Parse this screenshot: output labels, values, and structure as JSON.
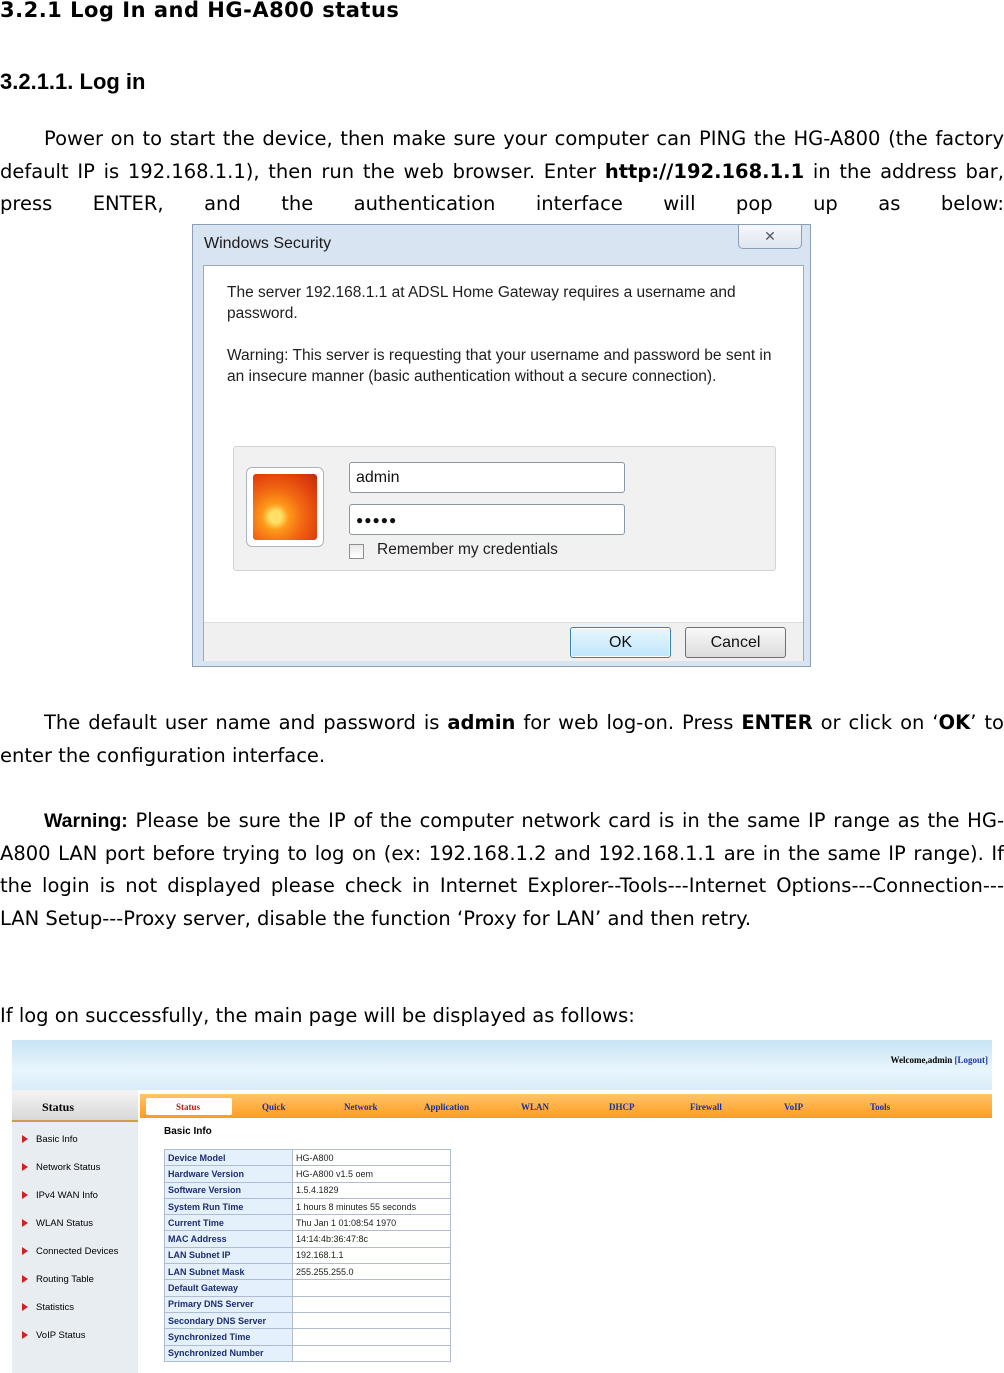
{
  "heading_1": "3.2.1  Log In and HG-A800 status",
  "heading_2": "3.2.1.1.   Log in",
  "para1": {
    "pre": "Power on to start the device, then make sure your computer can PING the HG-A800 (the factory default IP is 192.168.1.1), then run the web browser. Enter ",
    "url": "http://192.168.1.1",
    "post": " in the address bar, press ENTER, and the authentication interface will pop up as below:"
  },
  "dialog": {
    "title": "Windows Security",
    "close_label": "✕",
    "message1": "The server 192.168.1.1 at ADSL Home Gateway requires a username and password.",
    "message2": "Warning: This server is requesting that your username and password be sent in an insecure manner (basic authentication without a secure connection).",
    "username": "admin",
    "password": "●●●●●",
    "remember_label": "Remember my credentials",
    "ok_label": "OK",
    "cancel_label": "Cancel"
  },
  "para2": {
    "t1": "The default user name and password is ",
    "b1": "admin",
    "t2": " for web log-on. Press ",
    "b2": "ENTER",
    "t3": " or click on ‘",
    "b3": "OK",
    "t4": "’ to enter the configuration interface."
  },
  "para3": {
    "label": "Warning:",
    "text": " Please be sure the IP of the computer network card is in the same IP range as the HG-A800 LAN port before trying to log on (ex: 192.168.1.2 and 192.168.1.1 are in the same IP range). If the login is not displayed please check in Internet Explorer--Tools---Internet Options---Connection---LAN Setup---Proxy server, disable the function ‘Proxy for LAN’ and then retry."
  },
  "para4": "If log on successfully, the main page will be displayed as follows:",
  "router_ui": {
    "welcome": "Welcome,admin",
    "logout": "[Logout]",
    "left_header": "Status",
    "left_items": [
      "Basic Info",
      "Network Status",
      "IPv4 WAN Info",
      "WLAN Status",
      "Connected Devices",
      "Routing Table",
      "Statistics",
      "VoIP Status"
    ],
    "menu_active": "Status",
    "menu": [
      "Quick",
      "Network",
      "Application",
      "WLAN",
      "DHCP",
      "Firewall",
      "VoIP",
      "Tools"
    ],
    "section_title": "Basic Info",
    "rows": [
      {
        "k": "Device Model",
        "v": "HG-A800"
      },
      {
        "k": "Hardware Version",
        "v": "HG-A800 v1.5 oem"
      },
      {
        "k": "Software Version",
        "v": "1.5.4.1829"
      },
      {
        "k": "System Run Time",
        "v": "1 hours 8 minutes 55 seconds"
      },
      {
        "k": "Current Time",
        "v": "Thu Jan 1 01:08:54 1970"
      },
      {
        "k": "MAC Address",
        "v": "14:14:4b:36:47:8c"
      },
      {
        "k": "LAN Subnet IP",
        "v": "192.168.1.1"
      },
      {
        "k": "LAN Subnet Mask",
        "v": "255.255.255.0"
      },
      {
        "k": "Default Gateway",
        "v": ""
      },
      {
        "k": "Primary DNS Server",
        "v": ""
      },
      {
        "k": "Secondary DNS Server",
        "v": ""
      },
      {
        "k": "Synchronized Time",
        "v": ""
      },
      {
        "k": "Synchronized Number",
        "v": ""
      }
    ]
  }
}
